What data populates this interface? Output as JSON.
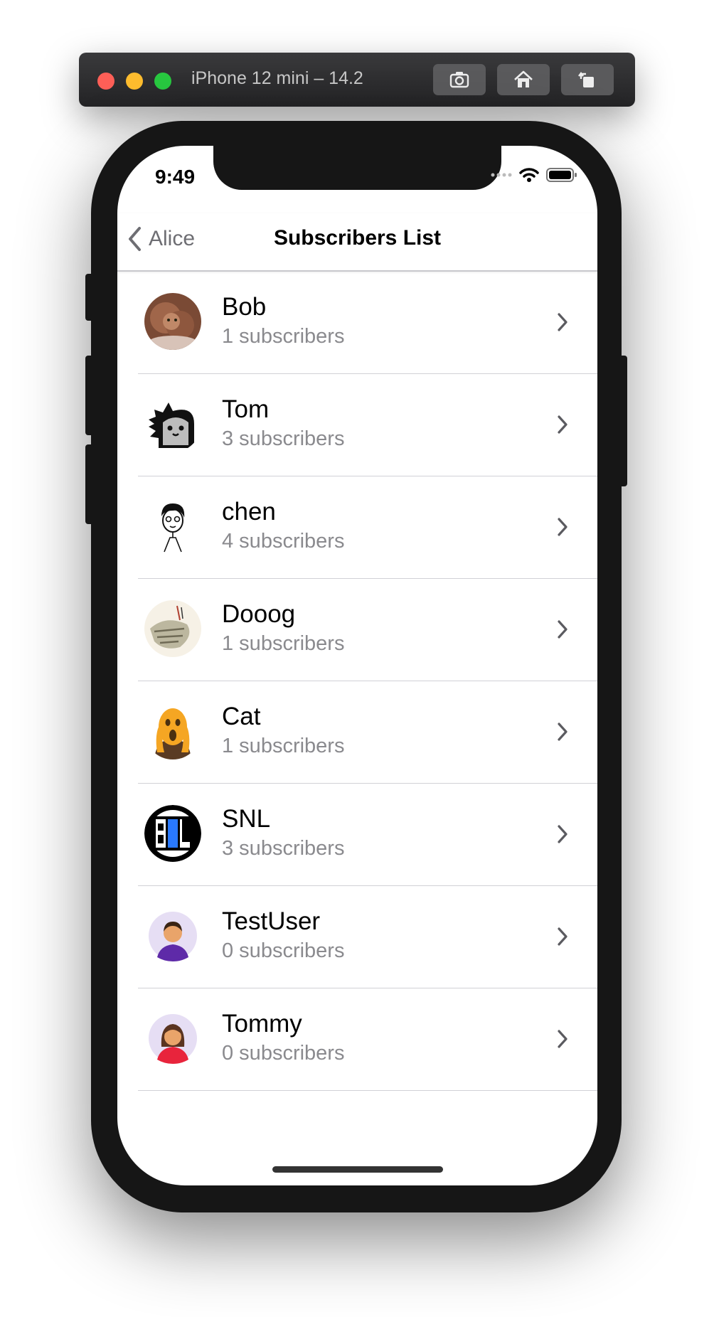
{
  "simulator": {
    "title": "iPhone 12 mini – 14.2",
    "buttons": [
      "screenshot-icon",
      "home-icon",
      "rotate-icon"
    ]
  },
  "status_bar": {
    "time": "9:49"
  },
  "nav": {
    "back_label": "Alice",
    "title": "Subscribers List"
  },
  "subscribers": [
    {
      "name": "Bob",
      "subscribers": "1 subscribers",
      "avatar": "dog-photo"
    },
    {
      "name": "Tom",
      "subscribers": "3 subscribers",
      "avatar": "ghost-monster"
    },
    {
      "name": "chen",
      "subscribers": "4 subscribers",
      "avatar": "sketch-man"
    },
    {
      "name": "Dooog",
      "subscribers": "1 subscribers",
      "avatar": "painting"
    },
    {
      "name": "Cat",
      "subscribers": "1 subscribers",
      "avatar": "scream-emoji"
    },
    {
      "name": "SNL",
      "subscribers": "3 subscribers",
      "avatar": "snl-logo"
    },
    {
      "name": "TestUser",
      "subscribers": "0 subscribers",
      "avatar": "male-avatar"
    },
    {
      "name": "Tommy",
      "subscribers": "0 subscribers",
      "avatar": "female-avatar"
    }
  ]
}
